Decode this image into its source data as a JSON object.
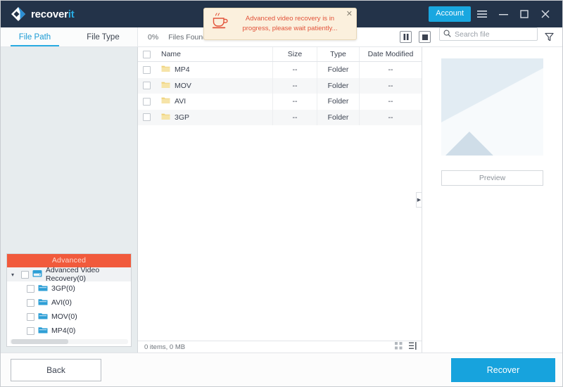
{
  "app": {
    "brand_main": "recover",
    "brand_accent": "it",
    "accent_color": "#29abe2",
    "titlebar_color": "#233349"
  },
  "titlebar": {
    "account_label": "Account",
    "icons": [
      {
        "name": "menu-icon"
      },
      {
        "name": "minimize-icon"
      },
      {
        "name": "maximize-icon"
      },
      {
        "name": "close-icon"
      }
    ]
  },
  "tabs": [
    {
      "label": "File Path",
      "active": true
    },
    {
      "label": "File Type",
      "active": false
    }
  ],
  "toolbar": {
    "progress_percent": "0%",
    "files_found_label": "Files Found:",
    "pause_title": "Pause",
    "stop_title": "Stop",
    "search_placeholder": "Search file",
    "search_value": "",
    "filter_title": "Filter"
  },
  "notification": {
    "message": "Advanced video recovery is in progress, please wait patiently...",
    "icon": "coffee-cup-icon",
    "close_label": "✕",
    "text_color": "#e2533a",
    "background_color": "#fbf0dd"
  },
  "tree": {
    "header": "Advanced",
    "header_color": "#f15a3c",
    "root": {
      "label": "Advanced Video Recovery(0)",
      "expanded": true
    },
    "children": [
      {
        "label": "3GP(0)"
      },
      {
        "label": "AVI(0)"
      },
      {
        "label": "MOV(0)"
      },
      {
        "label": "MP4(0)"
      }
    ]
  },
  "table": {
    "columns": [
      "Name",
      "Size",
      "Type",
      "Date Modified"
    ],
    "rows": [
      {
        "name": "MP4",
        "size": "--",
        "type": "Folder",
        "date": "--"
      },
      {
        "name": "MOV",
        "size": "--",
        "type": "Folder",
        "date": "--"
      },
      {
        "name": "AVI",
        "size": "--",
        "type": "Folder",
        "date": "--"
      },
      {
        "name": "3GP",
        "size": "--",
        "type": "Folder",
        "date": "--"
      }
    ],
    "status": "0 items, 0 MB"
  },
  "preview": {
    "button_label": "Preview"
  },
  "footer": {
    "back_label": "Back",
    "recover_label": "Recover",
    "recover_color": "#17a3dd"
  }
}
